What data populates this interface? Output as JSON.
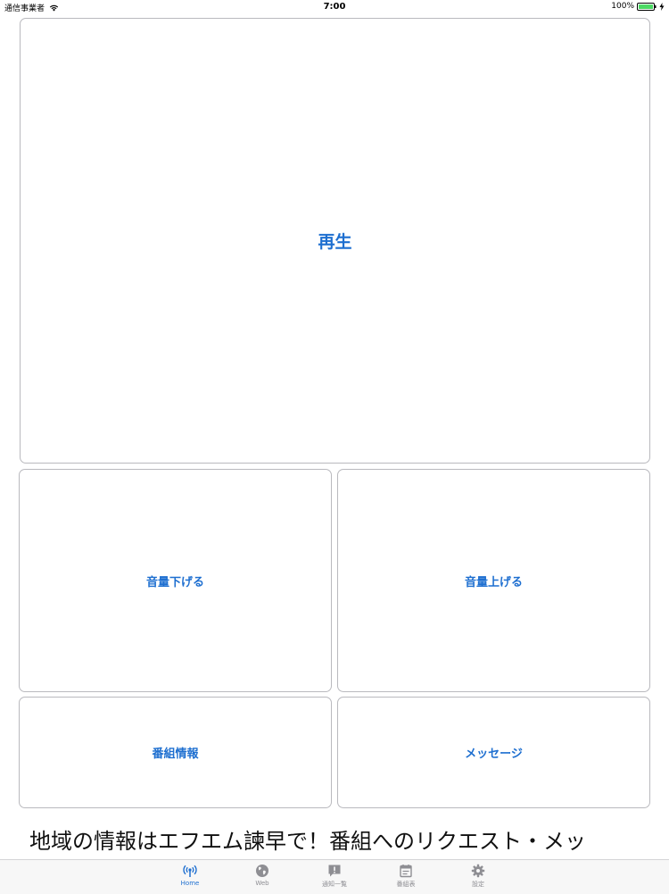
{
  "status_bar": {
    "carrier": "通信事業者",
    "time": "7:00",
    "battery": "100%"
  },
  "buttons": {
    "play": "再生",
    "volume_down": "音量下げる",
    "volume_up": "音量上げる",
    "program_info": "番組情報",
    "message": "メッセージ"
  },
  "ticker": {
    "text": "地域の情報はエフエム諫早で！番組へのリクエスト・メッ"
  },
  "tab_bar": {
    "tabs": [
      {
        "label": "Home",
        "icon": "antenna-icon",
        "active": true
      },
      {
        "label": "Web",
        "icon": "globe-icon",
        "active": false
      },
      {
        "label": "通知一覧",
        "icon": "notice-icon",
        "active": false
      },
      {
        "label": "番組表",
        "icon": "calendar-icon",
        "active": false
      },
      {
        "label": "設定",
        "icon": "gear-icon",
        "active": false
      }
    ]
  },
  "colors": {
    "accent": "#1e6fd0",
    "tab_inactive": "#8e8e93",
    "battery": "#4cd964"
  }
}
